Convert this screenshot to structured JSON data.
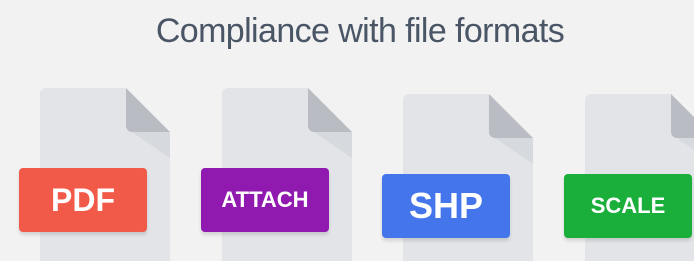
{
  "header": {
    "title": "Compliance with file formats"
  },
  "formats": [
    {
      "label": "PDF",
      "color": "#f15a49",
      "icon": "file-icon"
    },
    {
      "label": "ATTACH",
      "color": "#9019b0",
      "icon": "file-icon"
    },
    {
      "label": "SHP",
      "color": "#4575ea",
      "icon": "file-icon"
    },
    {
      "label": "SCALE",
      "color": "#1aae3a",
      "icon": "file-icon"
    }
  ],
  "colors": {
    "background": "#f2f2f2",
    "title": "#4a5566",
    "document": "#e2e4e7",
    "fold": "#b9bdc3"
  }
}
